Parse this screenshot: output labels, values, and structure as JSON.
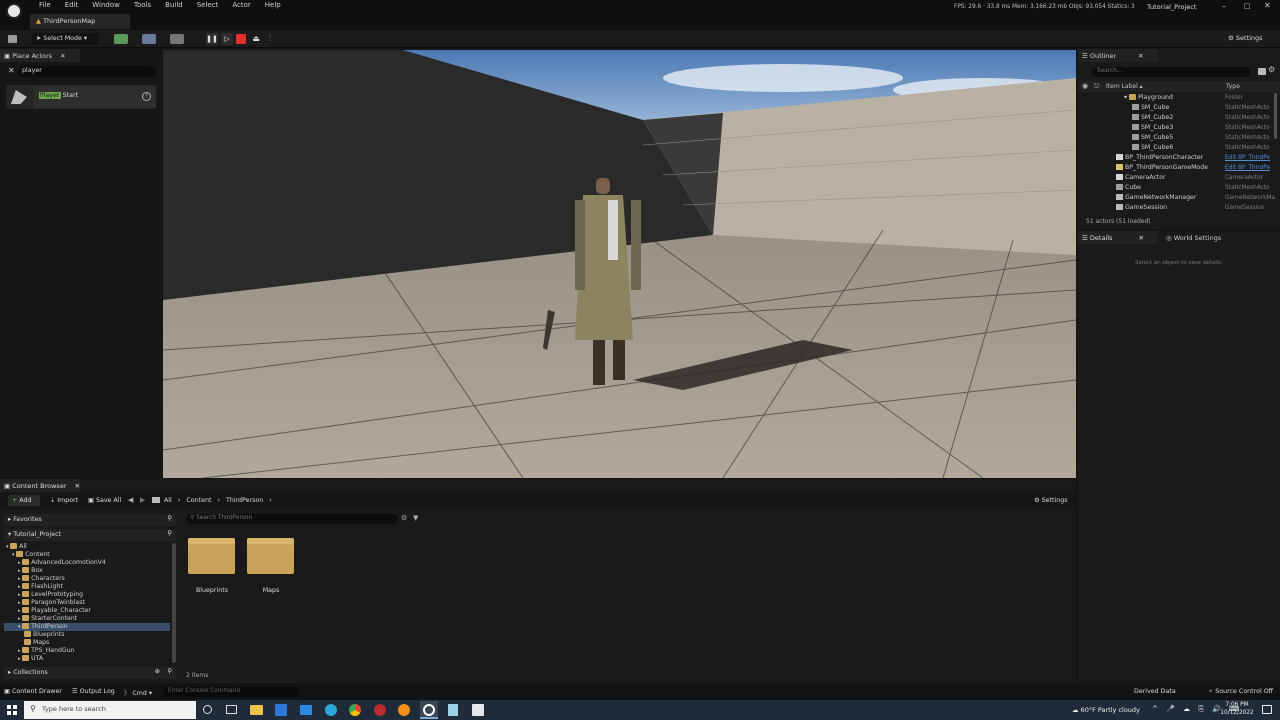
{
  "title_bar": {
    "tab": "ThirdPersonMap",
    "menu": [
      "File",
      "Edit",
      "Window",
      "Tools",
      "Build",
      "Select",
      "Actor",
      "Help"
    ],
    "stats": {
      "fps": "FPS: 29.6",
      "ms": "· 33.8 ms",
      "mem": "Mem: 3,166.23 mb",
      "objs": "Objs: 93,054",
      "statics": "Statics: 3"
    },
    "project": "Tutorial_Project"
  },
  "toolbar": {
    "select_mode": "Select Mode",
    "settings": "Settings"
  },
  "place_actors": {
    "title": "Place Actors",
    "search_value": "player",
    "result_highlight": "Player",
    "result_rest": "Start"
  },
  "outliner": {
    "title": "Outliner",
    "search_placeholder": "Search...",
    "col_label": "Item Label ▴",
    "col_type": "Type",
    "rows": [
      {
        "label": "Playground",
        "type": "Folder",
        "indent": 1,
        "icon": "folder"
      },
      {
        "label": "SM_Cube",
        "type": "StaticMeshActo",
        "indent": 2,
        "icon": "mesh"
      },
      {
        "label": "SM_Cube2",
        "type": "StaticMeshActo",
        "indent": 2,
        "icon": "mesh"
      },
      {
        "label": "SM_Cube3",
        "type": "StaticMeshActo",
        "indent": 2,
        "icon": "mesh"
      },
      {
        "label": "SM_Cube5",
        "type": "StaticMeshActo",
        "indent": 2,
        "icon": "mesh"
      },
      {
        "label": "SM_Cube6",
        "type": "StaticMeshActo",
        "indent": 2,
        "icon": "mesh"
      },
      {
        "label": "BP_ThirdPersonCharacter",
        "type": "Edit BP_ThirdPe",
        "indent": 0,
        "icon": "pawn",
        "edit": true
      },
      {
        "label": "BP_ThirdPersonGameMode",
        "type": "Edit BP_ThirdPe",
        "indent": 0,
        "icon": "gamemode",
        "edit": true
      },
      {
        "label": "CameraActor",
        "type": "CameraActor",
        "indent": 0,
        "icon": "camera"
      },
      {
        "label": "Cube",
        "type": "StaticMeshActo",
        "indent": 0,
        "icon": "mesh"
      },
      {
        "label": "GameNetworkManager",
        "type": "GameNetworkMa",
        "indent": 0,
        "icon": "actor"
      },
      {
        "label": "GameSession",
        "type": "GameSession",
        "indent": 0,
        "icon": "actor"
      }
    ],
    "count": "51 actors (51 loaded)"
  },
  "details": {
    "tab_details": "Details",
    "tab_world": "World Settings",
    "empty": "Select an object to view details."
  },
  "content_browser": {
    "title": "Content Browser",
    "add": "Add",
    "import": "Import",
    "save_all": "Save All",
    "crumb_all": "All",
    "crumb_content": "Content",
    "crumb_tp": "ThirdPerson",
    "settings": "Settings",
    "favorites": "Favorites",
    "project": "Tutorial_Project",
    "search_placeholder": "Search ThirdPerson",
    "tree": [
      {
        "label": "All",
        "indent": 0
      },
      {
        "label": "Content",
        "indent": 1
      },
      {
        "label": "AdvancedLocomotionV4",
        "indent": 2
      },
      {
        "label": "Box",
        "indent": 2
      },
      {
        "label": "Characters",
        "indent": 2
      },
      {
        "label": "FlashLight",
        "indent": 2
      },
      {
        "label": "LevelPrototyping",
        "indent": 2
      },
      {
        "label": "ParagonTwinblast",
        "indent": 2
      },
      {
        "label": "Playable_Character",
        "indent": 2
      },
      {
        "label": "StarterContent",
        "indent": 2
      },
      {
        "label": "ThirdPerson",
        "indent": 2,
        "selected": true
      },
      {
        "label": "Blueprints",
        "indent": 3
      },
      {
        "label": "Maps",
        "indent": 3
      },
      {
        "label": "TPS_HandGun",
        "indent": 2
      },
      {
        "label": "UTA",
        "indent": 2
      }
    ],
    "assets": [
      "Blueprints",
      "Maps"
    ],
    "item_count": "2 items",
    "collections": "Collections"
  },
  "status_bar": {
    "content_drawer": "Content Drawer",
    "output_log": "Output Log",
    "cmd": "Cmd",
    "console_placeholder": "Enter Console Command",
    "derived_data": "Derived Data",
    "source_control": "Source Control Off"
  },
  "taskbar": {
    "search_placeholder": "Type here to search",
    "weather": "60°F  Partly cloudy",
    "time": "7:06 PM",
    "date": "10/12/2022"
  }
}
